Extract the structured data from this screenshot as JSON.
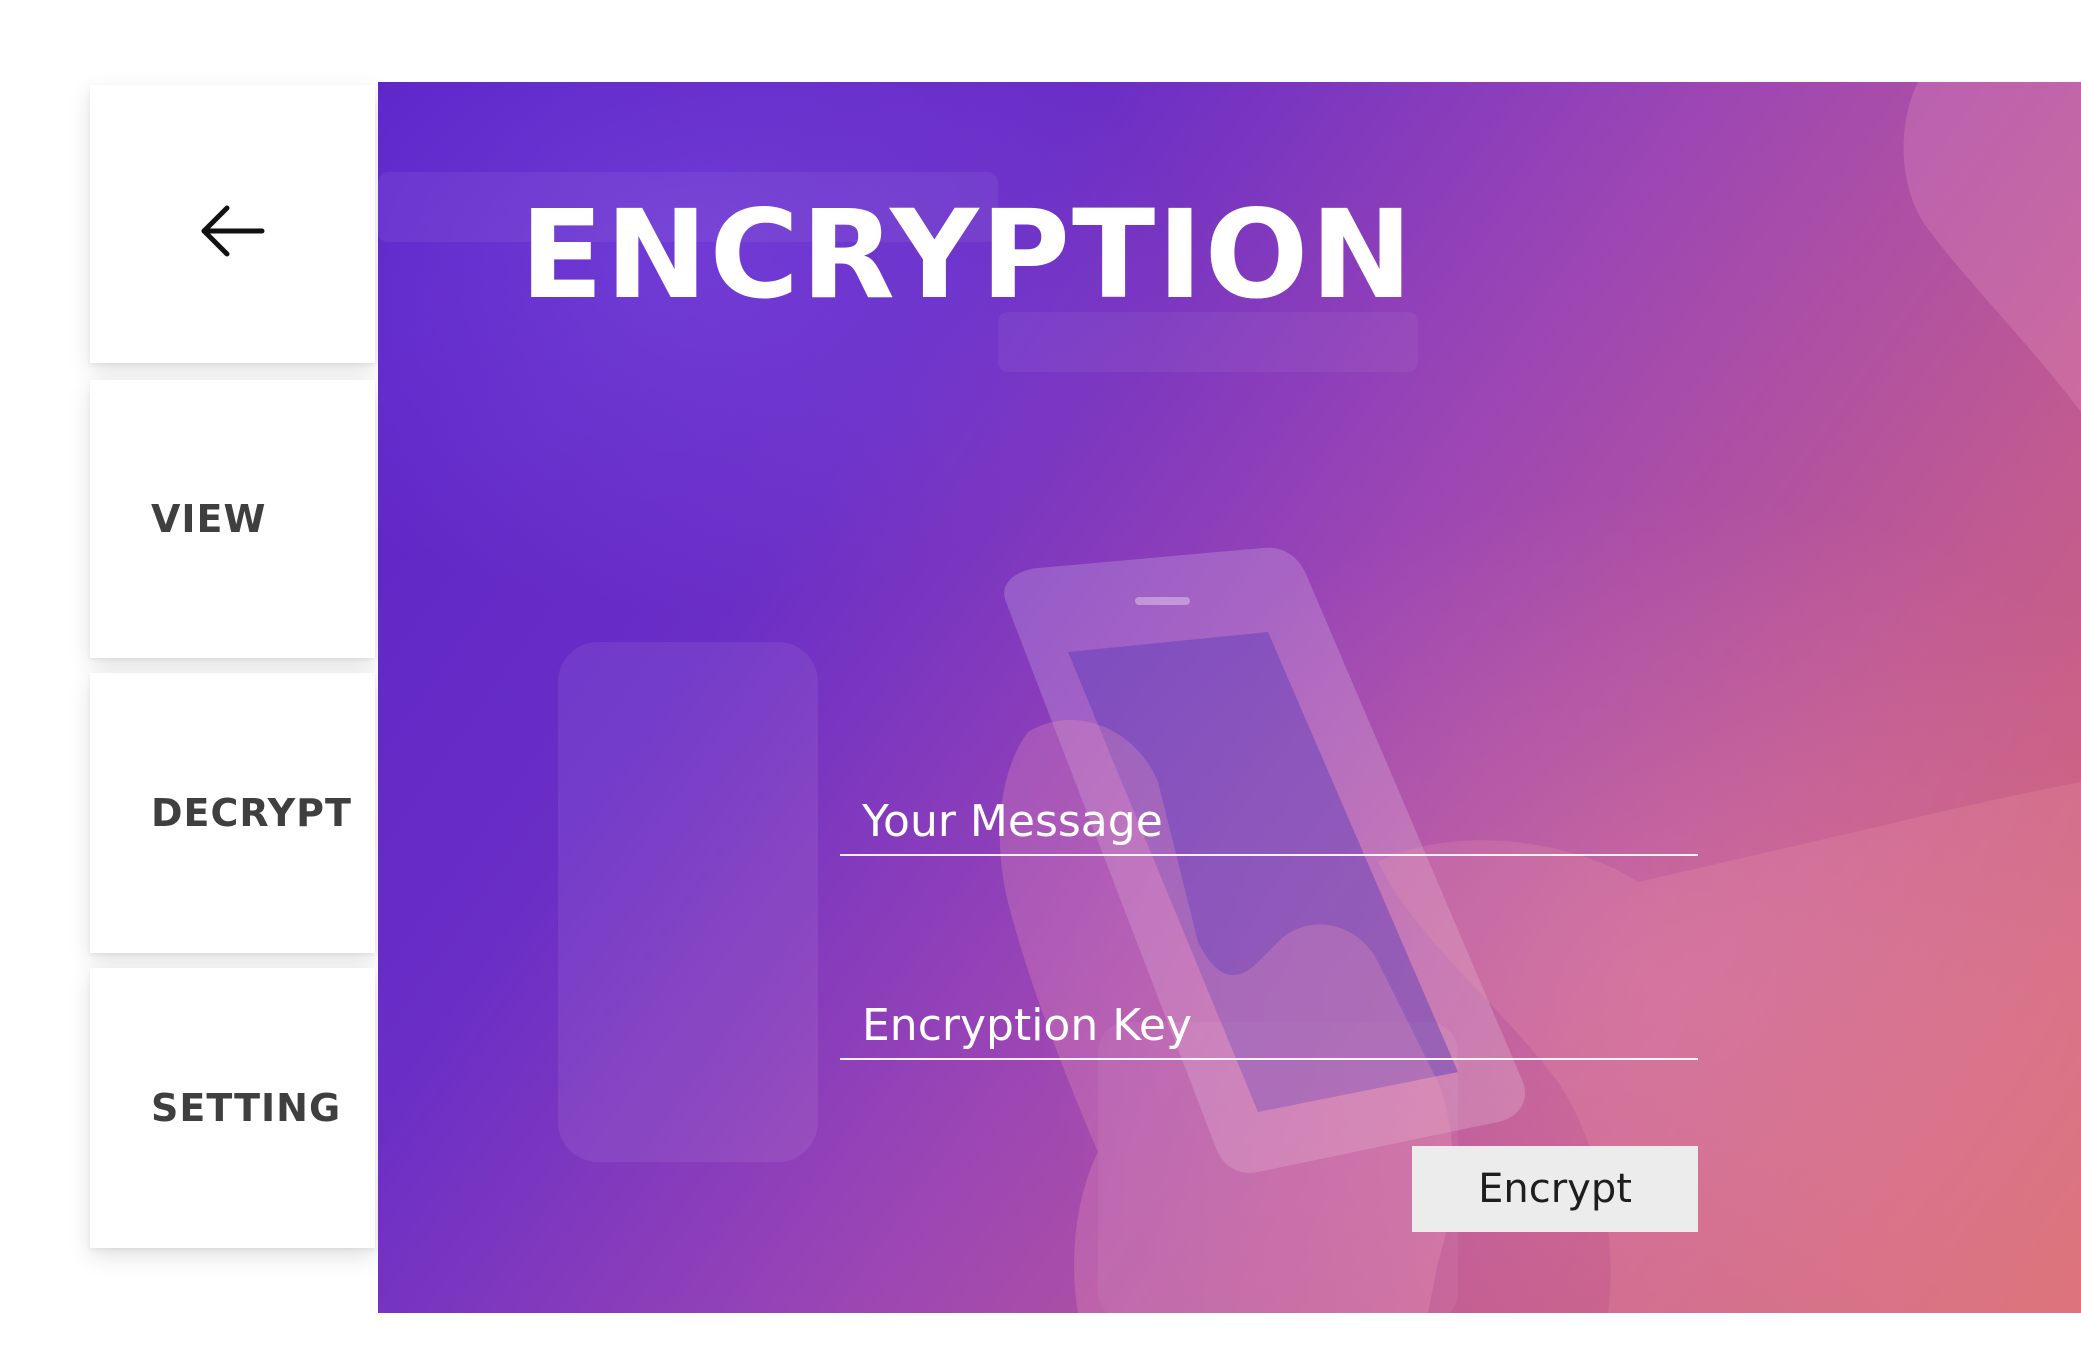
{
  "sidebar": {
    "back_icon": "arrow-left-icon",
    "items": [
      {
        "label": "VIEW"
      },
      {
        "label": "DECRYPT"
      },
      {
        "label": "SETTING"
      }
    ]
  },
  "main": {
    "title": "ENCRYPTION",
    "message_field": {
      "placeholder": "Your Message",
      "value": ""
    },
    "key_field": {
      "placeholder": "Encryption Key",
      "value": ""
    },
    "encrypt_button": {
      "label": "Encrypt"
    }
  },
  "colors": {
    "gradient_start": "#5a23c8",
    "gradient_end": "#d7686e",
    "sidebar_text": "#3f3f3f",
    "button_bg": "#ececec"
  }
}
